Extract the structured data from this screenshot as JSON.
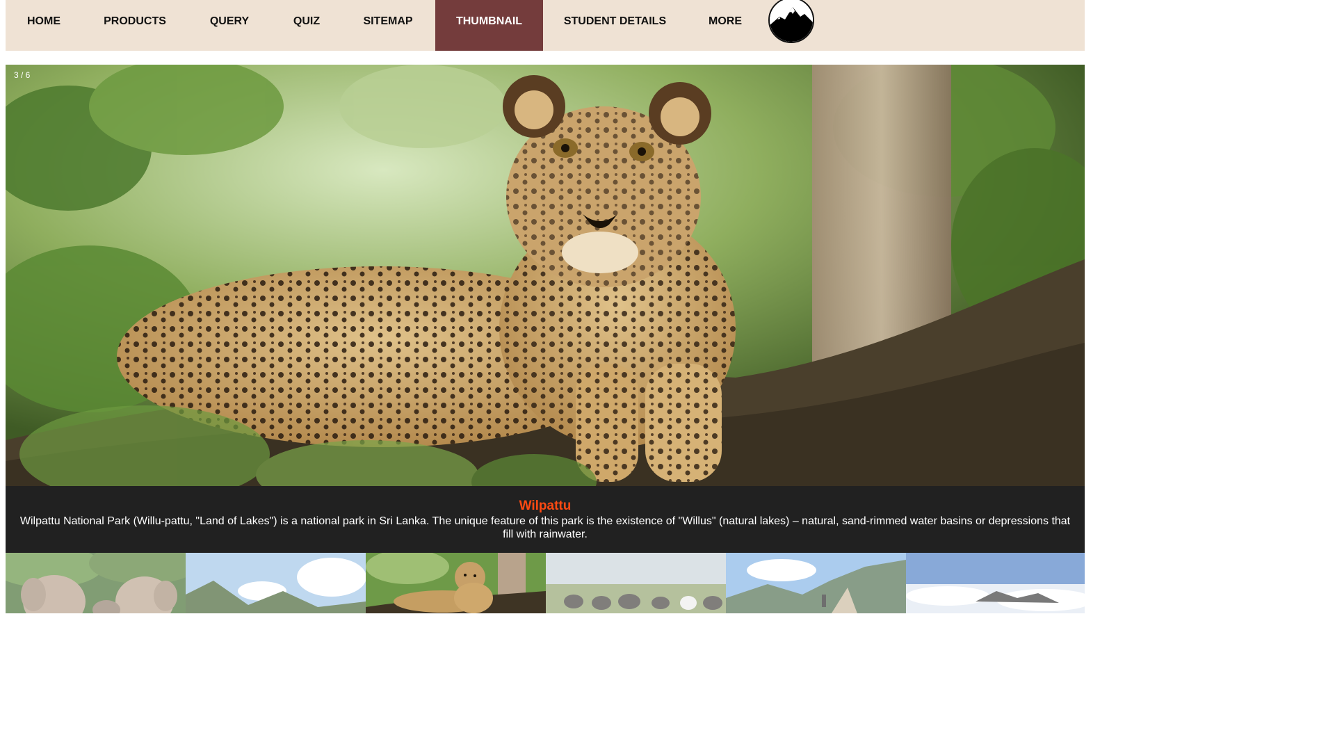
{
  "nav": {
    "items": [
      {
        "label": "HOME"
      },
      {
        "label": "PRODUCTS"
      },
      {
        "label": "QUERY"
      },
      {
        "label": "QUIZ"
      },
      {
        "label": "SITEMAP"
      },
      {
        "label": "THUMBNAIL",
        "active": true
      },
      {
        "label": "STUDENT DETAILS"
      },
      {
        "label": "MORE"
      }
    ],
    "logo_icon": "mountain-logo-icon"
  },
  "slideshow": {
    "counter": "3 / 6",
    "current_image": "leopard-on-branch",
    "caption_title": "Wilpattu",
    "caption_text": "Wilpattu National Park (Willu-pattu, \"Land of Lakes\") is a national park in Sri Lanka. The unique feature of this park is the existence of \"Willus\" (natural lakes) – natural, sand-rimmed water basins or depressions that fill with rainwater."
  },
  "thumbnails": [
    {
      "image": "elephants"
    },
    {
      "image": "mountain-sky"
    },
    {
      "image": "leopard",
      "active": true
    },
    {
      "image": "elephant-herd-plain"
    },
    {
      "image": "mountain-trail"
    },
    {
      "image": "sea-of-clouds"
    }
  ],
  "colors": {
    "nav_bg": "#efe2d4",
    "nav_active": "#743c3c",
    "caption_bg": "#212121",
    "caption_title": "#ff4a12"
  }
}
